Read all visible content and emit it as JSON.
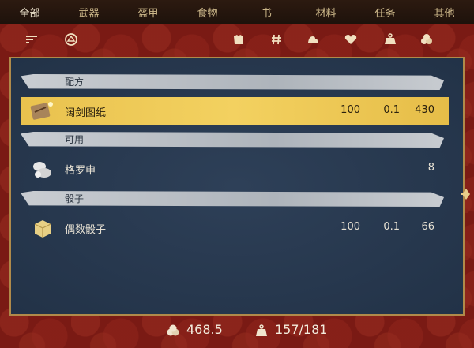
{
  "tabs": [
    {
      "label": "全部",
      "active": true
    },
    {
      "label": "武器"
    },
    {
      "label": "盔甲"
    },
    {
      "label": "食物"
    },
    {
      "label": "书"
    },
    {
      "label": "材料"
    },
    {
      "label": "任务"
    },
    {
      "label": "其他"
    }
  ],
  "toolbar": {
    "icons": [
      "sort-icon",
      "equip-filter-icon",
      "armor-icon",
      "hash-icon",
      "strength-icon",
      "heart-icon",
      "weight-icon",
      "coins-icon"
    ]
  },
  "sections": {
    "recipe": {
      "label": "配方"
    },
    "usable": {
      "label": "可用"
    },
    "dice": {
      "label": "骰子"
    }
  },
  "items": {
    "broadsword_blueprint": {
      "name": "阔剑图纸",
      "col1": "100",
      "col2": "0.1",
      "col3": "430",
      "selected": true
    },
    "grosh": {
      "name": "格罗申",
      "col3": "8"
    },
    "even_dice": {
      "name": "偶数骰子",
      "col1": "100",
      "col2": "0.1",
      "col3": "66"
    }
  },
  "footer": {
    "money": "468.5",
    "weight": "157/181"
  },
  "colors": {
    "frame_red": "#7a1a14",
    "panel_blue": "#2a3a50",
    "highlight_gold": "#f3d160"
  }
}
